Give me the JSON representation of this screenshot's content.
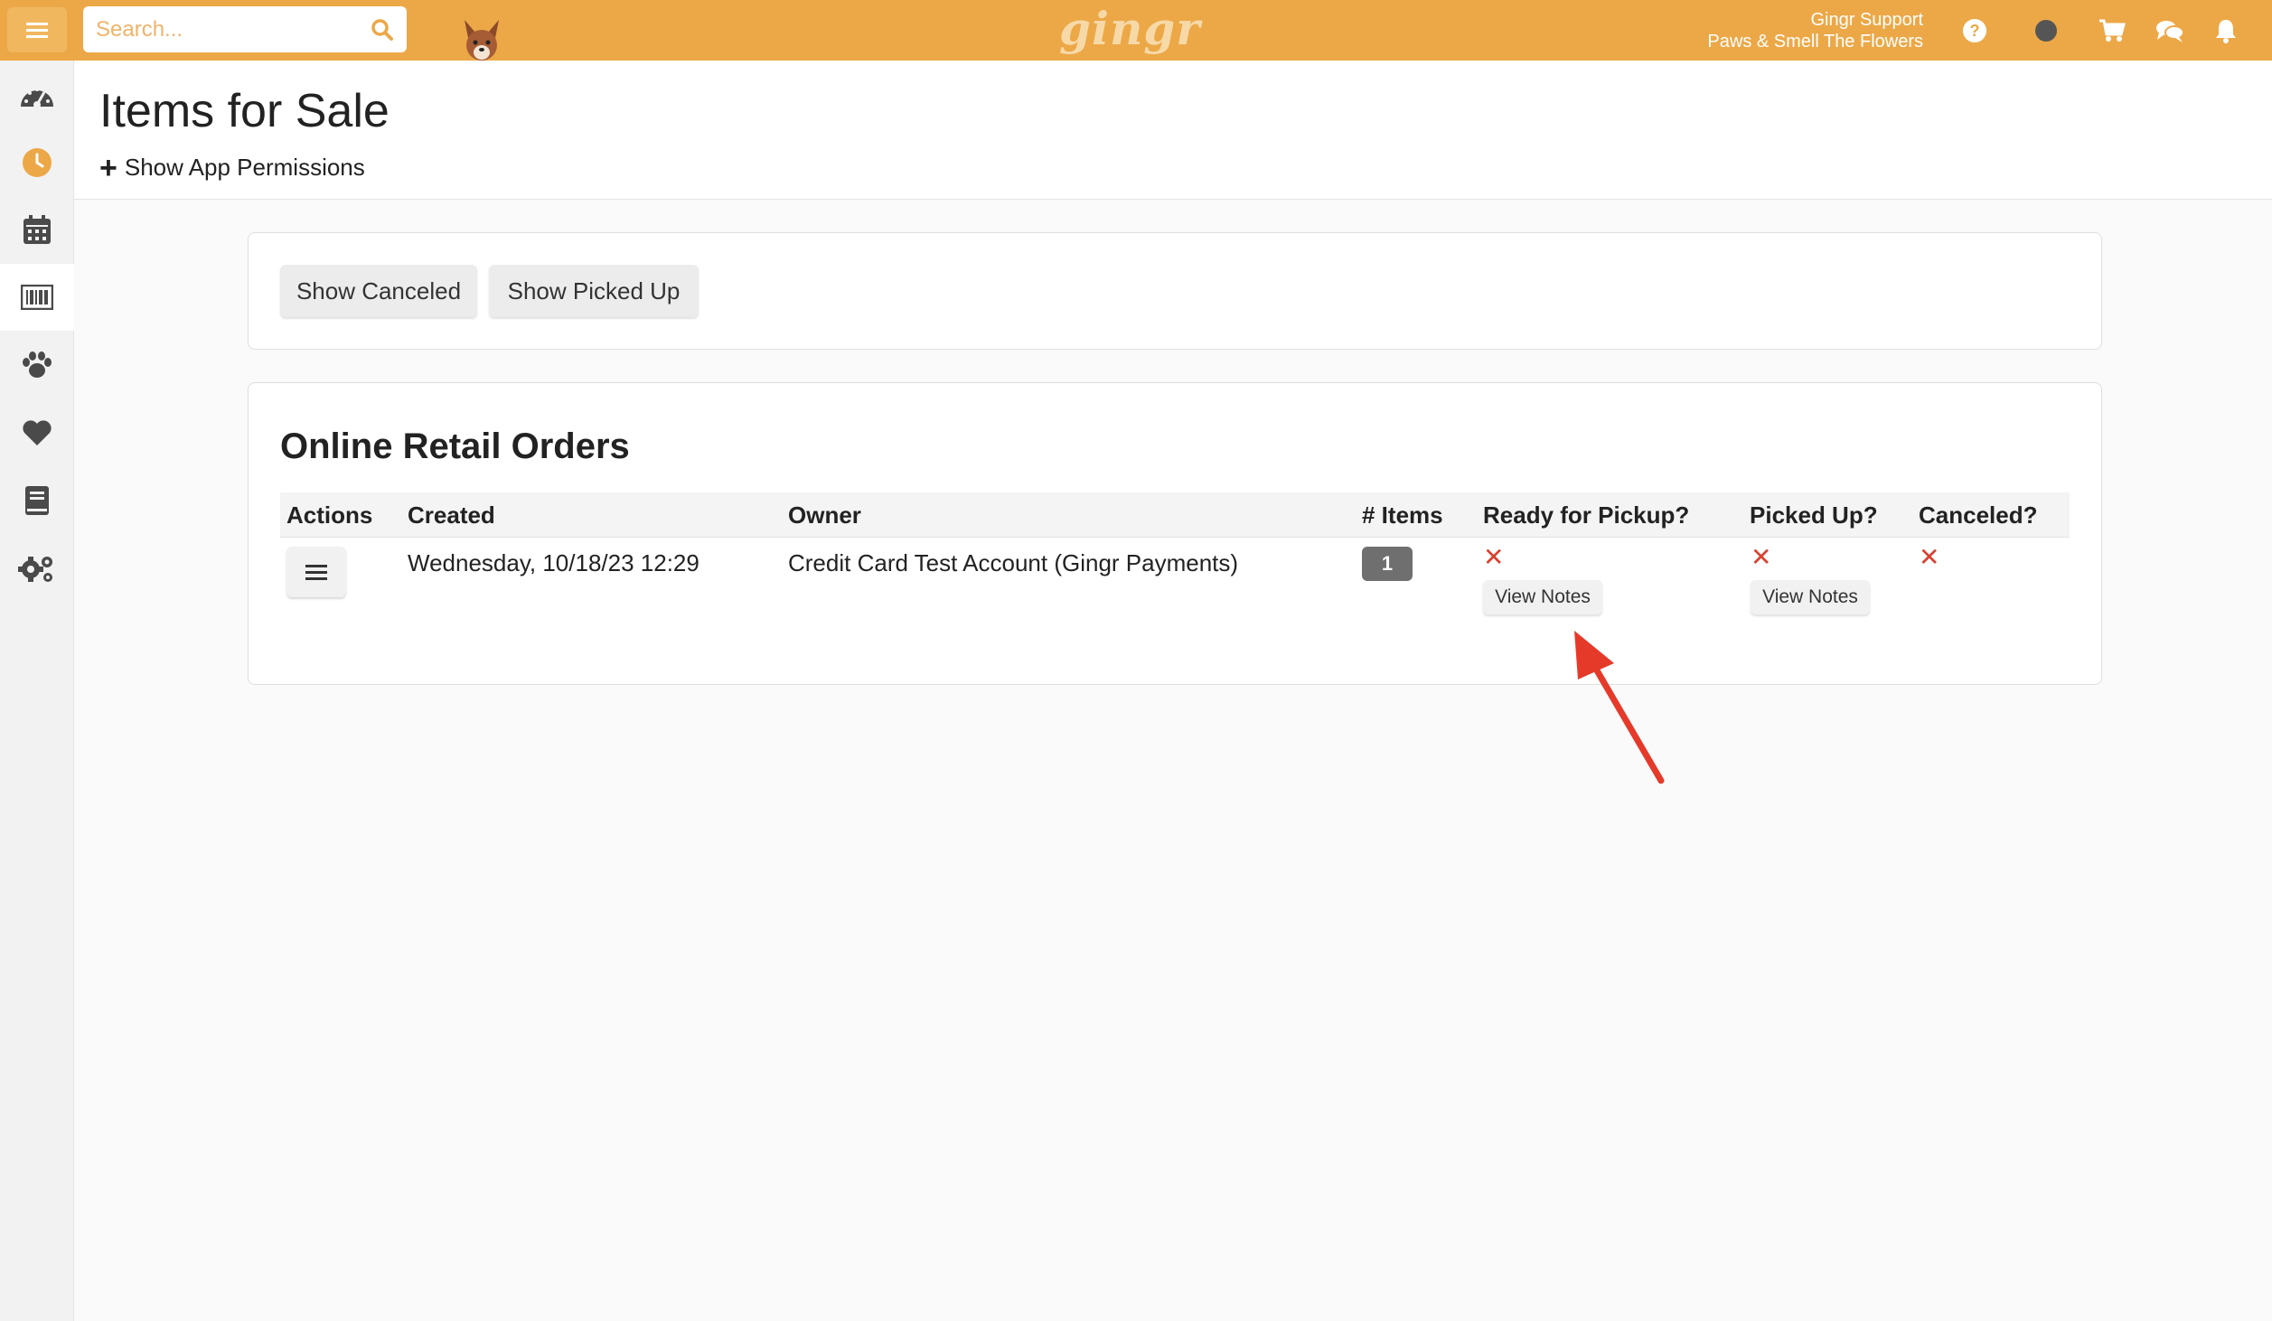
{
  "app": {
    "logo_text": "gingr",
    "brand_color": "#eca847"
  },
  "search": {
    "placeholder": "Search..."
  },
  "user": {
    "name": "Gingr Support",
    "location": "Paws & Smell The Flowers"
  },
  "topbar_icons": [
    "help-icon",
    "status-dot-icon",
    "cart-icon",
    "chat-icon",
    "bell-icon"
  ],
  "sidebar": {
    "items": [
      {
        "name": "dashboard",
        "icon": "speedometer-icon",
        "active": false
      },
      {
        "name": "clock",
        "icon": "clock-icon",
        "active": false
      },
      {
        "name": "calendar",
        "icon": "calendar-icon",
        "active": false
      },
      {
        "name": "retail",
        "icon": "barcode-icon",
        "active": true
      },
      {
        "name": "pets",
        "icon": "paw-icon",
        "active": false
      },
      {
        "name": "favorites",
        "icon": "heart-icon",
        "active": false
      },
      {
        "name": "reports",
        "icon": "book-icon",
        "active": false
      },
      {
        "name": "settings",
        "icon": "gears-icon",
        "active": false
      }
    ]
  },
  "page": {
    "title": "Items for Sale",
    "permissions_link": "Show App Permissions"
  },
  "filters": {
    "show_canceled": "Show Canceled",
    "show_picked_up": "Show Picked Up"
  },
  "orders": {
    "title": "Online Retail Orders",
    "columns": [
      "Actions",
      "Created",
      "Owner",
      "# Items",
      "Ready for Pickup?",
      "Picked Up?",
      "Canceled?"
    ],
    "rows": [
      {
        "created": "Wednesday, 10/18/23 12:29",
        "owner": "Credit Card Test Account (Gingr Payments)",
        "items": "1",
        "ready_for_pickup": false,
        "picked_up": false,
        "canceled": false,
        "view_notes_label": "View Notes"
      }
    ]
  },
  "annotation": {
    "arrow_color": "#e53a2a"
  }
}
